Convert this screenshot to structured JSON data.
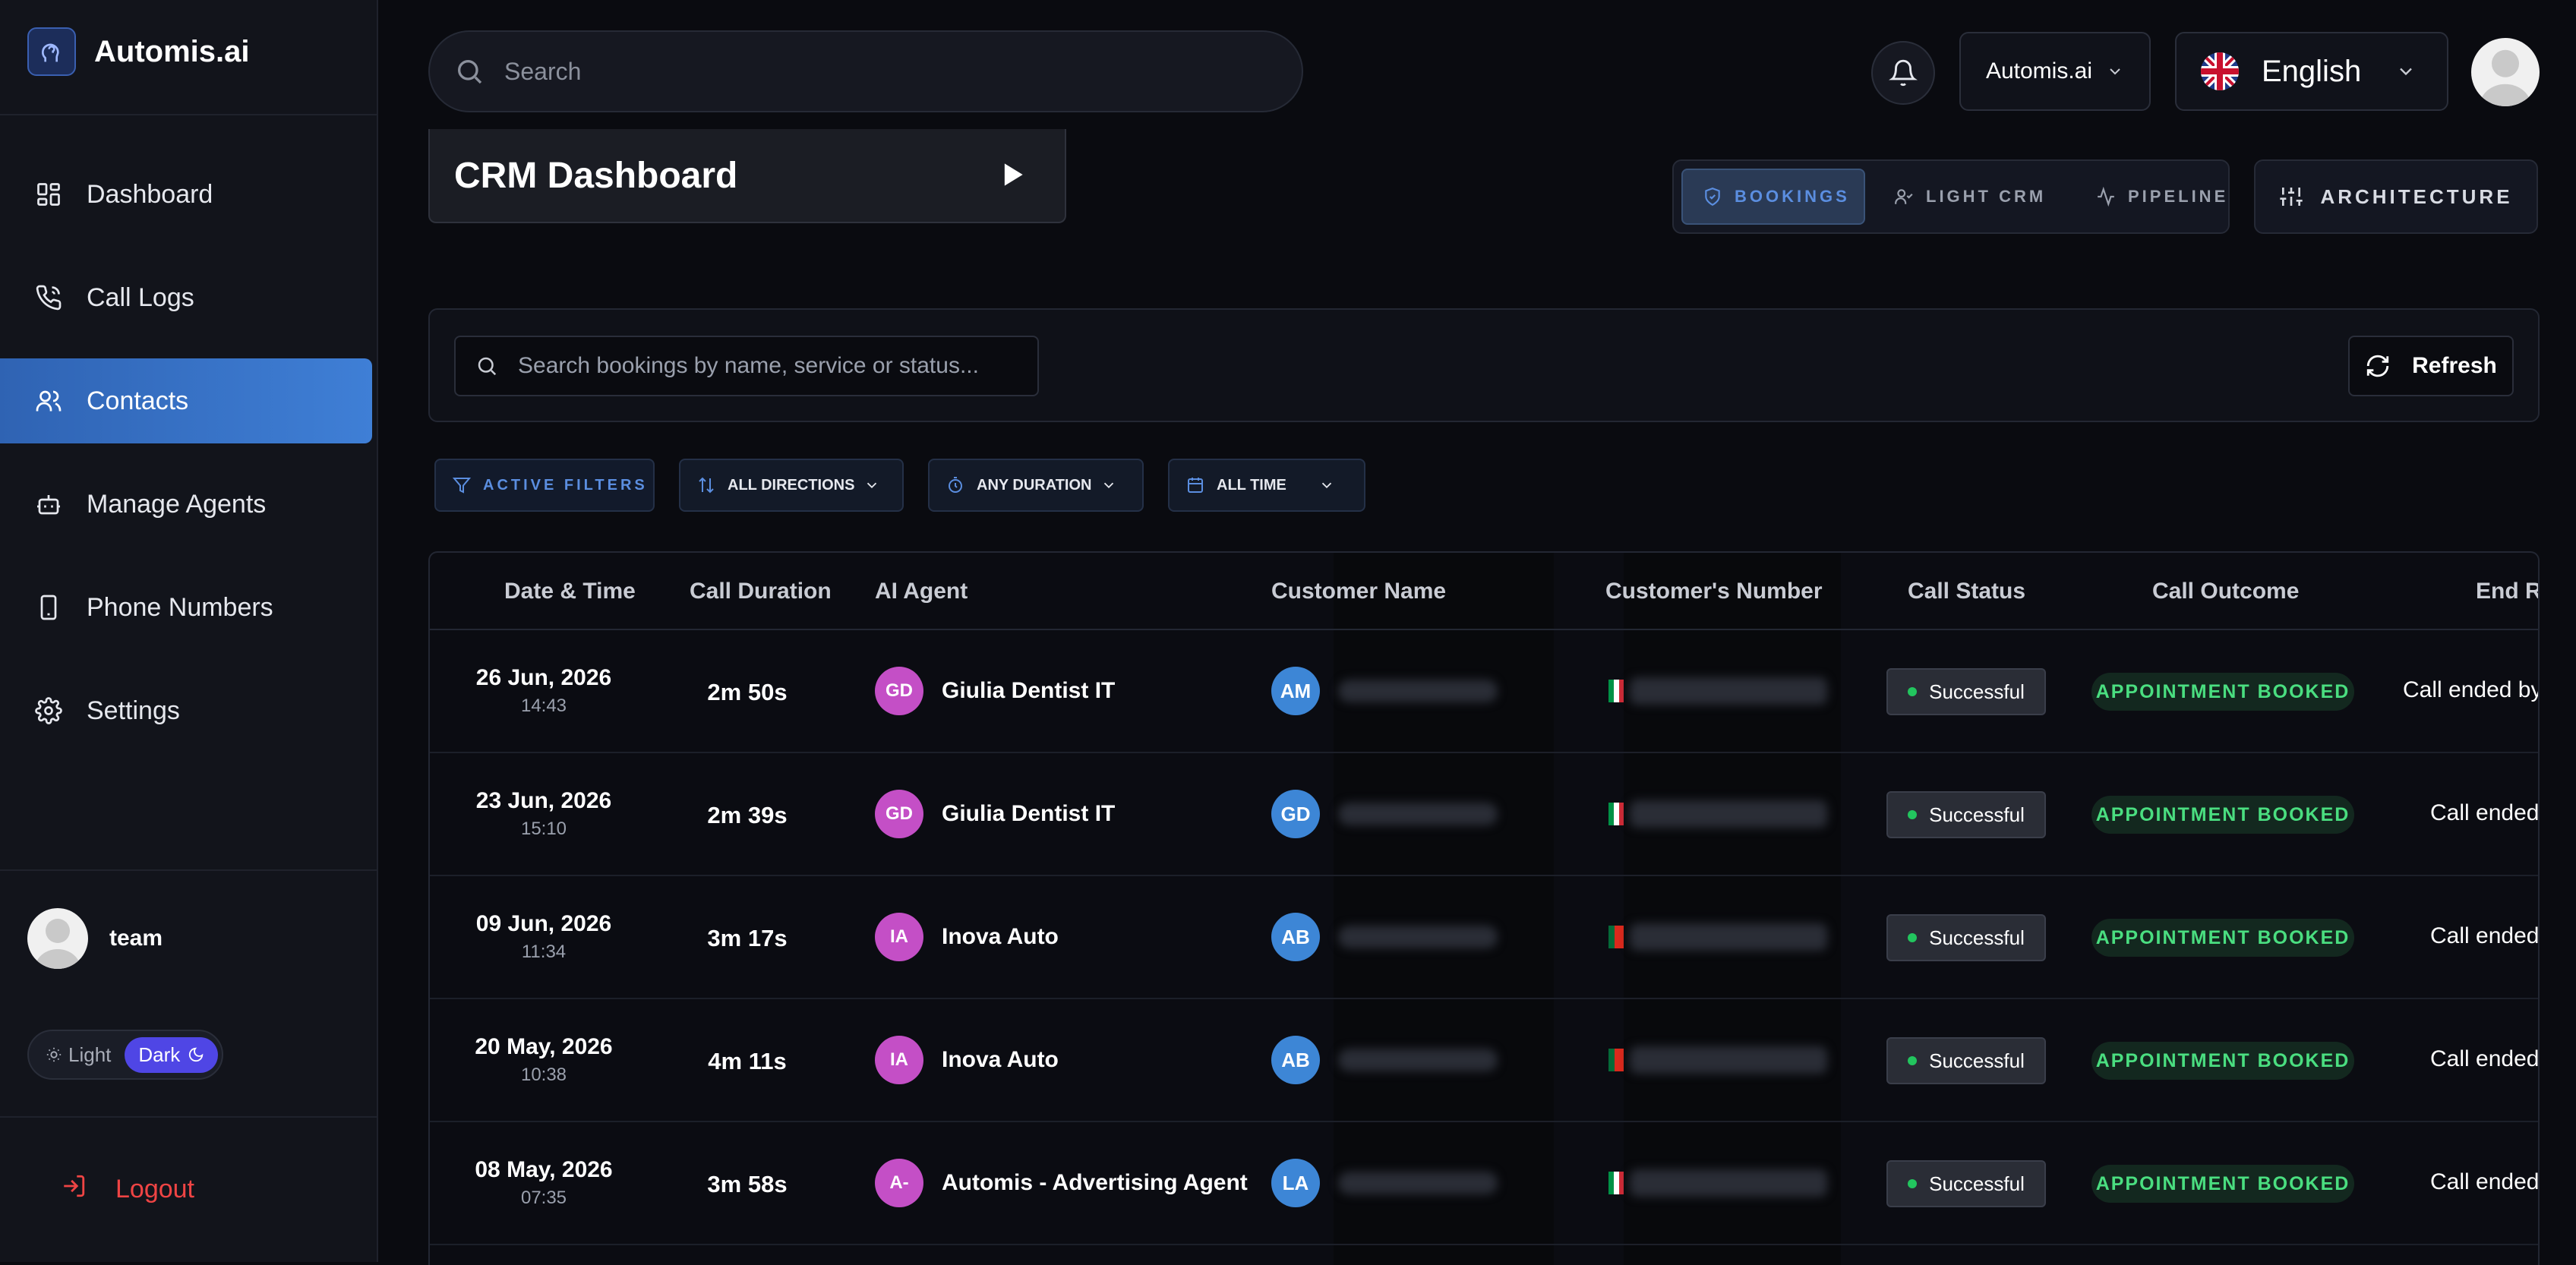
{
  "brand": {
    "name": "Automis.ai"
  },
  "sidebar": {
    "items": [
      {
        "label": "Dashboard",
        "icon": "dashboard-icon"
      },
      {
        "label": "Call Logs",
        "icon": "phone-icon"
      },
      {
        "label": "Contacts",
        "icon": "users-icon",
        "active": true
      },
      {
        "label": "Manage Agents",
        "icon": "robot-icon"
      },
      {
        "label": "Phone Numbers",
        "icon": "smartphone-icon"
      },
      {
        "label": "Settings",
        "icon": "gear-icon"
      }
    ],
    "user": {
      "name": "team"
    },
    "theme": {
      "light_label": "Light",
      "dark_label": "Dark",
      "selected": "Dark"
    },
    "logout_label": "Logout"
  },
  "topbar": {
    "search_placeholder": "Search",
    "org": "Automis.ai",
    "language": "English"
  },
  "page": {
    "title": "CRM Dashboard",
    "view_tabs": [
      {
        "label": "BOOKINGS",
        "icon": "shield-icon",
        "active": true
      },
      {
        "label": "LIGHT CRM",
        "icon": "user-icon"
      },
      {
        "label": "PIPELINE",
        "icon": "activity-icon"
      }
    ],
    "architecture_label": "ARCHITECTURE",
    "bookings_search_placeholder": "Search bookings by name, service or status...",
    "refresh_label": "Refresh",
    "filters": {
      "active_filters": "ACTIVE FILTERS",
      "direction": "ALL DIRECTIONS",
      "duration": "ANY DURATION",
      "time": "ALL TIME"
    }
  },
  "table": {
    "columns": [
      "Date & Time",
      "Call Duration",
      "AI Agent",
      "Customer Name",
      "Customer's Number",
      "Call Status",
      "Call Outcome",
      "End Re"
    ],
    "rows": [
      {
        "date": "26 Jun, 2026",
        "time": "14:43",
        "duration": "2m 50s",
        "agent_initials": "GD",
        "agent": "Giulia Dentist IT",
        "customer_initials": "AM",
        "status": "Successful",
        "outcome": "APPOINTMENT BOOKED",
        "end_reason": "Call ended by"
      },
      {
        "date": "23 Jun, 2026",
        "time": "15:10",
        "duration": "2m 39s",
        "agent_initials": "GD",
        "agent": "Giulia Dentist IT",
        "customer_initials": "GD",
        "status": "Successful",
        "outcome": "APPOINTMENT BOOKED",
        "end_reason": "Call ended"
      },
      {
        "date": "09 Jun, 2026",
        "time": "11:34",
        "duration": "3m 17s",
        "agent_initials": "IA",
        "agent": "Inova Auto",
        "customer_initials": "AB",
        "status": "Successful",
        "outcome": "APPOINTMENT BOOKED",
        "end_reason": "Call ended"
      },
      {
        "date": "20 May, 2026",
        "time": "10:38",
        "duration": "4m 11s",
        "agent_initials": "IA",
        "agent": "Inova Auto",
        "customer_initials": "AB",
        "status": "Successful",
        "outcome": "APPOINTMENT BOOKED",
        "end_reason": "Call ended"
      },
      {
        "date": "08 May, 2026",
        "time": "07:35",
        "duration": "3m 58s",
        "agent_initials": "A-",
        "agent": "Automis - Advertising Agent",
        "customer_initials": "LA",
        "status": "Successful",
        "outcome": "APPOINTMENT BOOKED",
        "end_reason": "Call ended"
      }
    ]
  },
  "colors": {
    "accent": "#3f7fd6",
    "success": "#22c55e",
    "outcome": "#4ade80",
    "logout": "#ef4444"
  }
}
